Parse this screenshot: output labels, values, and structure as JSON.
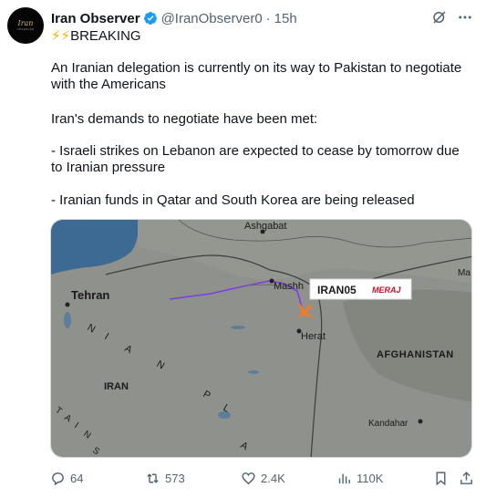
{
  "author": {
    "name": "Iran Observer",
    "handle": "@IranObserver0",
    "time": "15h",
    "avatar_text": "Iran",
    "avatar_subtext": "OBSERVER"
  },
  "header": {
    "separator": "·"
  },
  "breaking": {
    "bolts": "⚡⚡",
    "label": "BREAKING"
  },
  "body": {
    "line1": "An Iranian delegation is currently on its way to Pakistan to negotiate with the Americans",
    "line2": "Iran's demands to negotiate have been met:",
    "line3": "- Israeli strikes on Lebanon are expected to cease by tomorrow due to Iranian pressure",
    "line4": "- Iranian funds in Qatar and South Korea are being released"
  },
  "map": {
    "labels": {
      "ashgabat": "Ashgabat",
      "tehran": "Tehran",
      "mashhad": "Mashh",
      "herat": "Herat",
      "afghanistan": "AFGHANISTAN",
      "iran": "IRAN",
      "kandahar": "Kandahar",
      "ma": "Ma",
      "n": "N",
      "i": "I",
      "a": "A",
      "n2": "N",
      "p": "P",
      "l": "L",
      "a2": "A",
      "t": "T",
      "a3": "A",
      "i2": "I",
      "n3": "N",
      "s": "S"
    },
    "flight_callsign": "IRAN05",
    "airline": "MERAJ"
  },
  "actions": {
    "replies": "64",
    "reposts": "573",
    "likes": "2.4K",
    "views": "110K"
  },
  "colors": {
    "verified": "#1d9bf0",
    "bolt": "#f5b400",
    "flight_path": "#7b3fe4",
    "plane": "#f07b2a",
    "meraj": "#c8102e"
  }
}
